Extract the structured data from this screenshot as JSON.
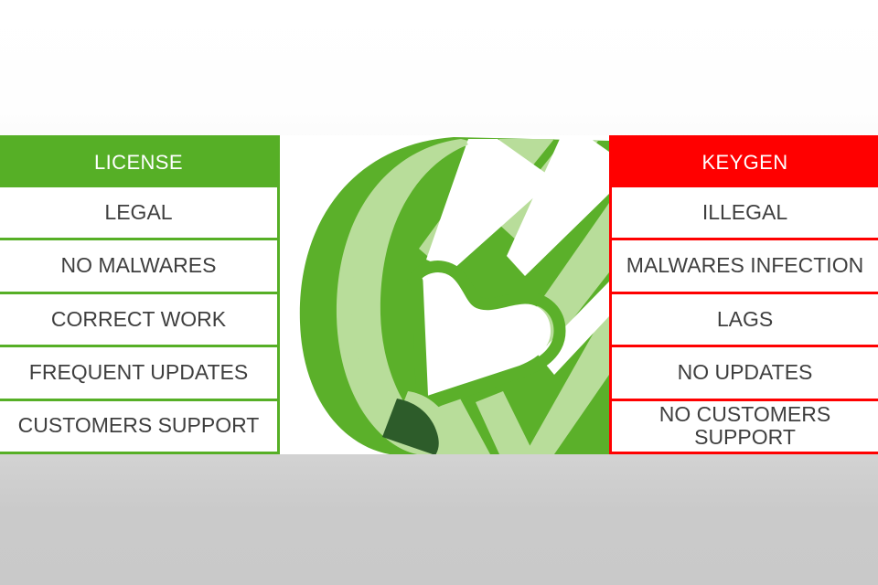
{
  "background": {
    "top_color": "#ffffff",
    "bottom_color": "#c9c9c9"
  },
  "comparison": {
    "left_panel": {
      "title": "LICENSE",
      "accent_color": "#56af26",
      "header_text_color": "#ffffff",
      "items": [
        "LEGAL",
        "NO MALWARES",
        "CORRECT WORK",
        "FREQUENT UPDATES",
        "CUSTOMERS SUPPORT"
      ]
    },
    "right_panel": {
      "title": "KEYGEN",
      "accent_color": "#ff0000",
      "header_text_color": "#ffffff",
      "items": [
        "ILLEGAL",
        "MALWARES INFECTION",
        "LAGS",
        "NO UPDATES",
        "NO CUSTOMERS SUPPORT"
      ]
    },
    "item_text_color": "#3f3f3f"
  },
  "center_illustration": {
    "name": "green-pencil-logo",
    "colors": {
      "body": "#5bb02a",
      "highlight": "#b8dd9a",
      "tip": "#2d5c2a",
      "paper": "#ffffff"
    }
  }
}
